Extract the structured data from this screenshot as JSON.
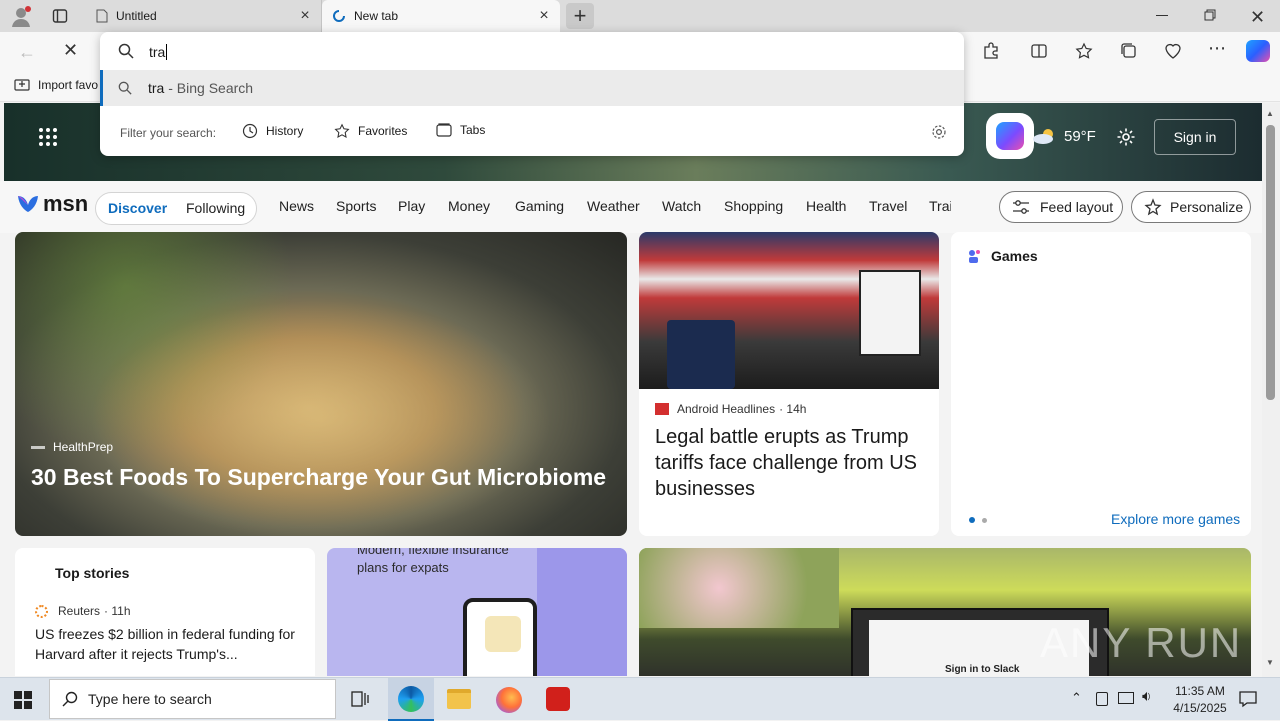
{
  "browser": {
    "tabs": [
      {
        "label": "Untitled"
      },
      {
        "label": "New tab"
      }
    ],
    "favorites_bar": {
      "import_label": "Import favo"
    },
    "accent": "#0f6cbd"
  },
  "omnibox": {
    "query": "tra",
    "suggestion": {
      "term": "tra",
      "source": " - Bing Search"
    },
    "filter_label": "Filter your search:",
    "filters": [
      {
        "label": "History",
        "icon": "clock-icon"
      },
      {
        "label": "Favorites",
        "icon": "star-icon"
      },
      {
        "label": "Tabs",
        "icon": "tabs-icon"
      }
    ]
  },
  "header": {
    "weather": "59°F",
    "sign_in": "Sign in"
  },
  "msn": {
    "logo": "msn",
    "segments": [
      "Discover",
      "Following"
    ],
    "nav": [
      "News",
      "Sports",
      "Play",
      "Money",
      "Gaming",
      "Weather",
      "Watch",
      "Shopping",
      "Health",
      "Travel",
      "Trai"
    ],
    "feed_layout": "Feed layout",
    "personalize": "Personalize"
  },
  "cards": {
    "hero": {
      "source": "HealthPrep",
      "title": "30 Best Foods To Supercharge Your Gut Microbiome"
    },
    "news": {
      "source": "Android Headlines",
      "age": "· 14h",
      "title": "Legal battle erupts as Trump tariffs face challenge from US businesses"
    },
    "games": {
      "title": "Games",
      "explore": "Explore more games"
    },
    "top_stories": {
      "title": "Top stories",
      "source": "Reuters",
      "age": "· 11h",
      "headline": "US freezes $2 billion in federal funding for Harvard after it rejects Trump's..."
    },
    "ad": {
      "text1": "Modern, flexible insurance",
      "text2": "plans for expats"
    },
    "slack": {
      "caption": "Sign in to Slack"
    }
  },
  "watermark": "ANY RUN",
  "taskbar": {
    "search_placeholder": "Type here to search",
    "time": "11:35 AM",
    "date": "4/15/2025"
  }
}
